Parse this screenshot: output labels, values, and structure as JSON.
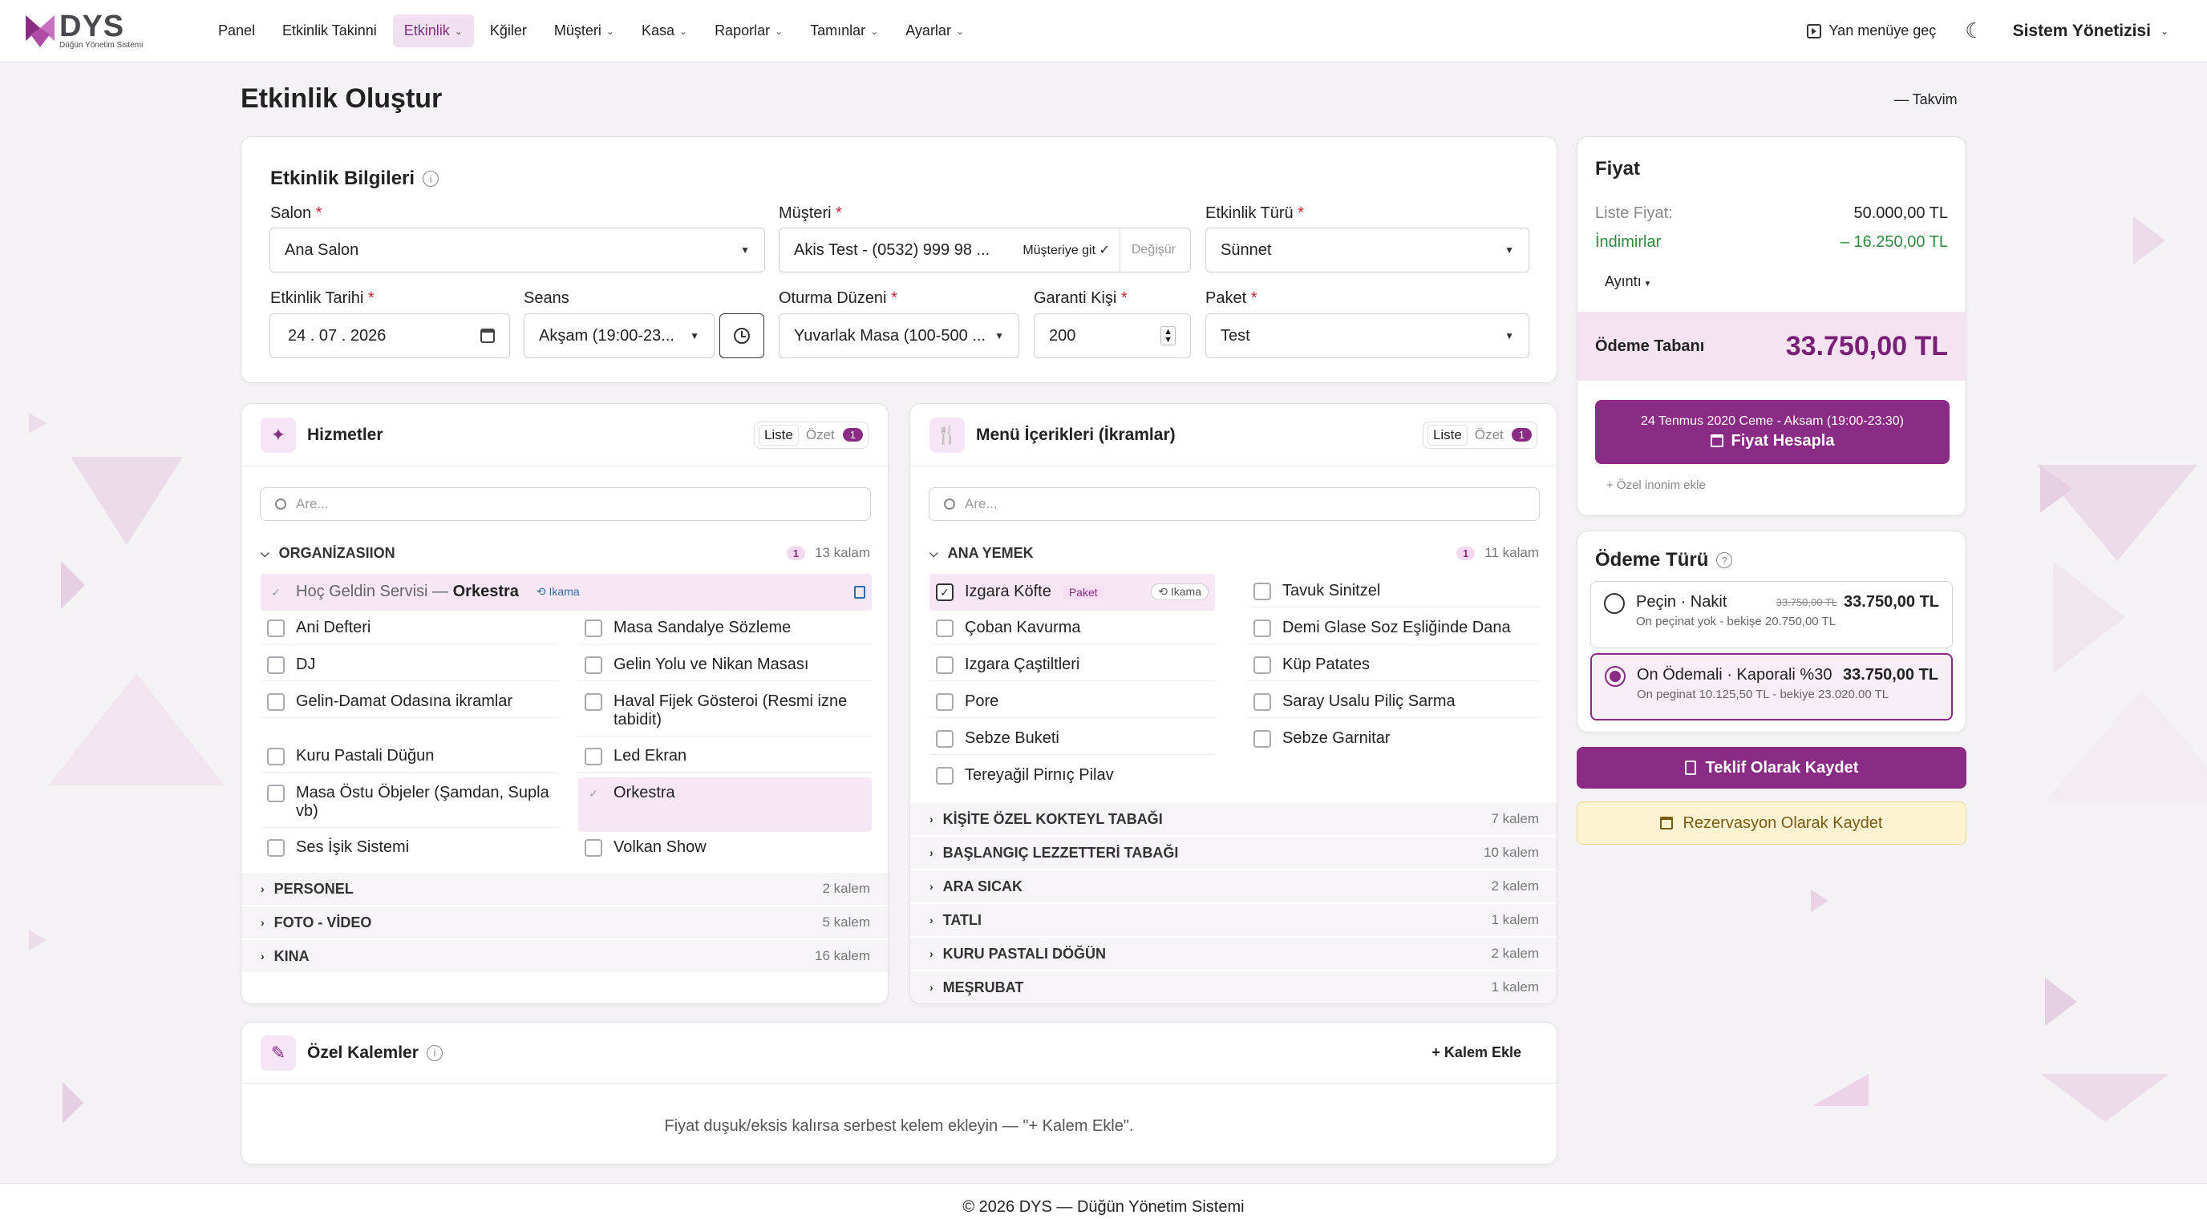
{
  "app": {
    "logo_title": "DYS",
    "logo_subtitle": "Düğün Yönetim Sistemi"
  },
  "nav": {
    "items": [
      {
        "label": "Panel",
        "dropdown": false
      },
      {
        "label": "Etkinlik Takinni",
        "dropdown": false
      },
      {
        "label": "Etkinlik",
        "dropdown": true
      },
      {
        "label": "Kğiler",
        "dropdown": false
      },
      {
        "label": "Müşteri",
        "dropdown": true
      },
      {
        "label": "Kasa",
        "dropdown": true
      },
      {
        "label": "Raporlar",
        "dropdown": true
      },
      {
        "label": "Tamınlar",
        "dropdown": true
      },
      {
        "label": "Ayarlar",
        "dropdown": true
      }
    ],
    "switch_label": "Yan menüye geç",
    "user": "Sistem Yönetizisi"
  },
  "page": {
    "title": "Etkinlik Oluştur",
    "calendar_link": "— Takvim"
  },
  "event_info": {
    "title": "Etkinlik Bilgileri",
    "salon_label": "Salon",
    "salon_value": "Ana Salon",
    "customer_label": "Müşteri",
    "customer_value": "Akis Test - (0532) 999 98 ...",
    "customer_goto": "Müşteriye git ✓",
    "customer_change": "Değişür",
    "type_label": "Etkinlik Türü",
    "type_value": "Sünnet",
    "date_label": "Etkinlik Tarihi",
    "date_value": "24 . 07 . 2026",
    "session_label": "Seans",
    "session_value": "Akşam (19:00-23...",
    "seating_label": "Oturma Düzeni",
    "seating_value": "Yuvarlak Masa (100-500 ...",
    "guarantee_label": "Garanti Kişi",
    "guarantee_value": "200",
    "package_label": "Paket",
    "package_value": "Test"
  },
  "services": {
    "title": "Hizmetler",
    "seg_list": "Liste",
    "seg_summary": "Özet",
    "seg_count": "1",
    "search_placeholder": "Are...",
    "group_open": {
      "name": "ORGANİZASIION",
      "pill": "1",
      "count": "13 kalam"
    },
    "selected": {
      "label": "Hoç Geldin Servisi — ",
      "strong": "Orkestra",
      "tag": "Ikama"
    },
    "left": [
      "Ani Defteri",
      "DJ",
      "Gelin-Damat Odasına ikramlar",
      "Kuru Pastali Düğun",
      "Masa Östu Öbjeler (Şamdan, Supla vb)",
      "Ses İşik Sistemi"
    ],
    "right": [
      "Masa Sandalye Sözleme",
      "Gelin Yolu ve Nikan Masası",
      "Haval Fijek Gösteroi (Resmi izne tabidit)",
      "Led Ekran",
      "Orkestra",
      "Volkan Show"
    ],
    "groups": [
      {
        "name": "PERSONEL",
        "count": "2 kalem"
      },
      {
        "name": "FOTO - VİDEO",
        "count": "5 kalem"
      },
      {
        "name": "KINA",
        "count": "16 kalem"
      }
    ]
  },
  "menu": {
    "title": "Menü İçerikleri (İkramlar)",
    "seg_list": "Liste",
    "seg_summary": "Özet",
    "seg_count": "1",
    "search_placeholder": "Are...",
    "group_open": {
      "name": "ANA YEMEK",
      "pill": "1",
      "count": "11 kalam"
    },
    "first": {
      "label": "Izgara Köfte",
      "tag": "Paket",
      "tag2": "Ikama"
    },
    "left": [
      "Çoban Kavurma",
      "Izgara Çaştiltleri",
      "Pore",
      "Sebze Buketi",
      "Tereyağil Pirnıç Pilav"
    ],
    "right": [
      "Tavuk Sinitzel",
      "Demi Glase Soz Eşliğinde Dana",
      "Küp Patates",
      "Saray Usalu Piliç Sarma",
      "Sebze Garnitar"
    ],
    "groups": [
      {
        "name": "KİŞİTE ÖZEL KOKTEYL TABAĞI",
        "count": "7 kalem"
      },
      {
        "name": "BAŞLANGIÇ LEZZETTERİ TABAĞI",
        "count": "10 kalem"
      },
      {
        "name": "ARA SICAK",
        "count": "2 kalem"
      },
      {
        "name": "TATLI",
        "count": "1 kalem"
      },
      {
        "name": "KURU PASTALI DÖĞÜN",
        "count": "2 kalem"
      },
      {
        "name": "MEŞRUBAT",
        "count": "1 kalem"
      }
    ]
  },
  "custom": {
    "title": "Özel Kalemler",
    "add": "+ Kalem Ekle",
    "empty": "Fiyat duşuk/eksis kalırsa serbest kelem ekleyin — \"+ Kalem Ekle\"."
  },
  "price": {
    "title": "Fiyat",
    "list_label": "Liste Fiyat:",
    "list_value": "50.000,00 TL",
    "discount_label": "İndimirlar",
    "discount_value": "– 16.250,00 TL",
    "detail": "Ayıntı",
    "base_label": "Ödeme Tabanı",
    "base_value": "33.750,00 TL",
    "calc_date": "24 Tenmus 2020 Ceme - Aksam (19:00-23:30)",
    "calc_button": "Fiyat Hesapla",
    "special_discount": "+ Özel inonim ekle"
  },
  "payment": {
    "title": "Ödeme Türü",
    "options": [
      {
        "name": "Peçin · Nakit",
        "old": "33.750,00 TL",
        "price": "33.750,00 TL",
        "note": "On peçinat yok - bekişe 20.750,00 TL",
        "selected": false
      },
      {
        "name": "On Ödemali · Kaporali %30",
        "old": "",
        "price": "33.750,00 TL",
        "note": "On peginat 10.125,50 TL - bekiye 23.020.00 TL",
        "selected": true
      }
    ]
  },
  "actions": {
    "offer": "Teklif Olarak Kaydet",
    "reserve": "Rezervasyon Olarak Kaydet"
  },
  "footer": "© 2026 DYS — Düğün Yönetim Sistemi",
  "colors": {
    "brand": "#8a2b85",
    "brand_soft": "#f6e5f4",
    "reserve_bg": "#fdf3d3",
    "discount": "#2e8a3e"
  }
}
